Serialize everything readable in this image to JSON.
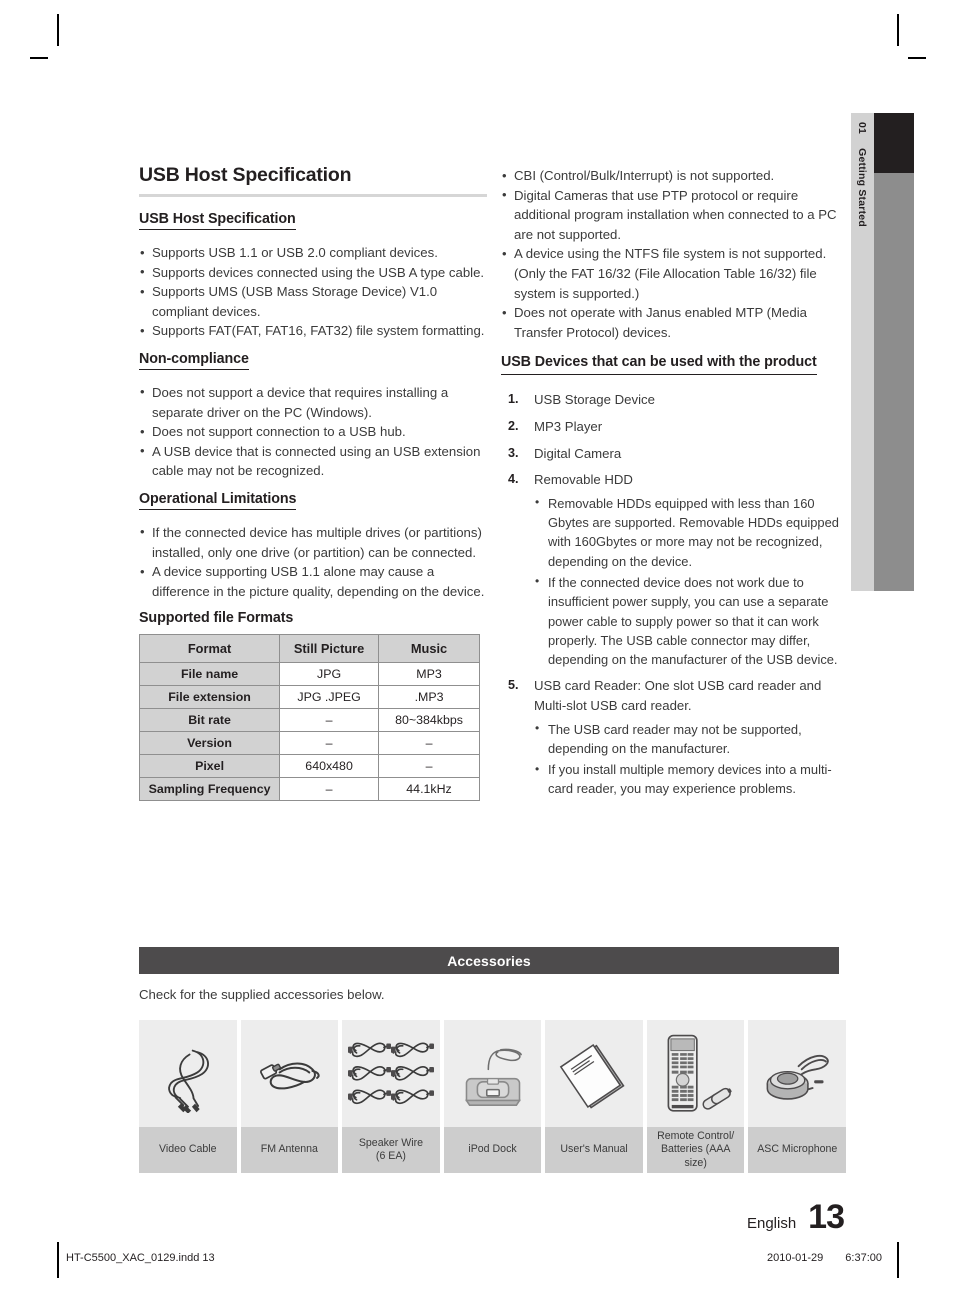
{
  "side_tab": {
    "number": "01",
    "label": "Getting Started"
  },
  "left_column": {
    "main_title": "USB Host Specification",
    "sections": [
      {
        "heading": "USB Host Specification",
        "heading_style": "underlined",
        "bullets": [
          "Supports USB 1.1 or USB 2.0 compliant devices.",
          "Supports devices connected using the USB A type cable.",
          "Supports UMS (USB Mass Storage Device) V1.0 compliant devices.",
          "Supports FAT(FAT, FAT16, FAT32) file system formatting."
        ]
      },
      {
        "heading": "Non-compliance",
        "heading_style": "underlined",
        "bullets": [
          "Does not support a device that requires installing a separate driver on the PC (Windows).",
          "Does not support connection to a USB hub.",
          "A USB device that is connected using an USB extension cable may not be recognized."
        ]
      },
      {
        "heading": "Operational Limitations",
        "heading_style": "underlined",
        "bullets": [
          "If the connected device has multiple drives (or partitions) installed, only one drive (or partition) can be connected.",
          "A device supporting USB 1.1 alone may cause a difference in the picture quality, depending on the device."
        ]
      }
    ],
    "table_title": "Supported file Formats",
    "table": {
      "columns": [
        "Format",
        "Still Picture",
        "Music"
      ],
      "rows": [
        {
          "label": "File name",
          "still_picture": "JPG",
          "music": "MP3"
        },
        {
          "label": "File extension",
          "still_picture": "JPG .JPEG",
          "music": ".MP3"
        },
        {
          "label": "Bit rate",
          "still_picture": "–",
          "music": "80~384kbps"
        },
        {
          "label": "Version",
          "still_picture": "–",
          "music": "–"
        },
        {
          "label": "Pixel",
          "still_picture": "640x480",
          "music": "–"
        },
        {
          "label": "Sampling Frequency",
          "still_picture": "–",
          "music": "44.1kHz"
        }
      ]
    }
  },
  "right_column": {
    "top_bullets": [
      "CBI (Control/Bulk/Interrupt) is not supported.",
      "Digital Cameras that use PTP protocol or require additional program installation when connected to a PC are not supported.",
      "A device using the NTFS file system is not supported. (Only the FAT 16/32 (File Allocation Table 16/32) file system is supported.)",
      "Does not operate with Janus enabled MTP (Media Transfer Protocol) devices."
    ],
    "devices_heading": "USB Devices that can be used with the product",
    "devices": [
      {
        "num": "1.",
        "text": "USB Storage Device",
        "sub": []
      },
      {
        "num": "2.",
        "text": "MP3 Player",
        "sub": []
      },
      {
        "num": "3.",
        "text": "Digital Camera",
        "sub": []
      },
      {
        "num": "4.",
        "text": "Removable HDD",
        "sub": [
          "Removable HDDs equipped with less than 160 Gbytes are supported. Removable HDDs equipped with 160Gbytes or more may not be recognized, depending on the device.",
          "If the connected device does not work due to insufficient power supply, you can use a separate power cable to supply power so that it can work properly. The USB cable connector may differ, depending on the manufacturer of the USB device."
        ]
      },
      {
        "num": "5.",
        "text": "USB card Reader: One slot USB card reader and Multi-slot USB card reader.",
        "sub": [
          "The USB card reader may not be supported, depending on the manufacturer.",
          "If you install multiple memory devices into a multi-card reader, you may experience problems."
        ]
      }
    ]
  },
  "accessories": {
    "bar_title": "Accessories",
    "note": "Check for the supplied accessories below.",
    "items": [
      {
        "icon": "video-cable-icon",
        "label": "Video Cable"
      },
      {
        "icon": "fm-antenna-icon",
        "label": "FM Antenna"
      },
      {
        "icon": "speaker-wire-icon",
        "label": "Speaker Wire\n(6 EA)"
      },
      {
        "icon": "ipod-dock-icon",
        "label": "iPod Dock"
      },
      {
        "icon": "users-manual-icon",
        "label": "User's Manual"
      },
      {
        "icon": "remote-control-icon",
        "label": "Remote Control/\nBatteries (AAA size)"
      },
      {
        "icon": "asc-microphone-icon",
        "label": "ASC Microphone"
      }
    ]
  },
  "footer": {
    "language": "English",
    "page_number": "13",
    "file_name": "HT-C5500_XAC_0129.indd   13",
    "date": "2010-01-29",
    "time": "6:37:00"
  },
  "colors": {
    "bar_dark": "#4d4b4c",
    "table_header": "#d2d2d2",
    "tab_light": "#d2d2d2",
    "tab_dark": "#231f20",
    "tab_gray": "#8d8d8d",
    "accessory_image_bg": "#ededed",
    "accessory_label_bg": "#cdcdcd"
  }
}
